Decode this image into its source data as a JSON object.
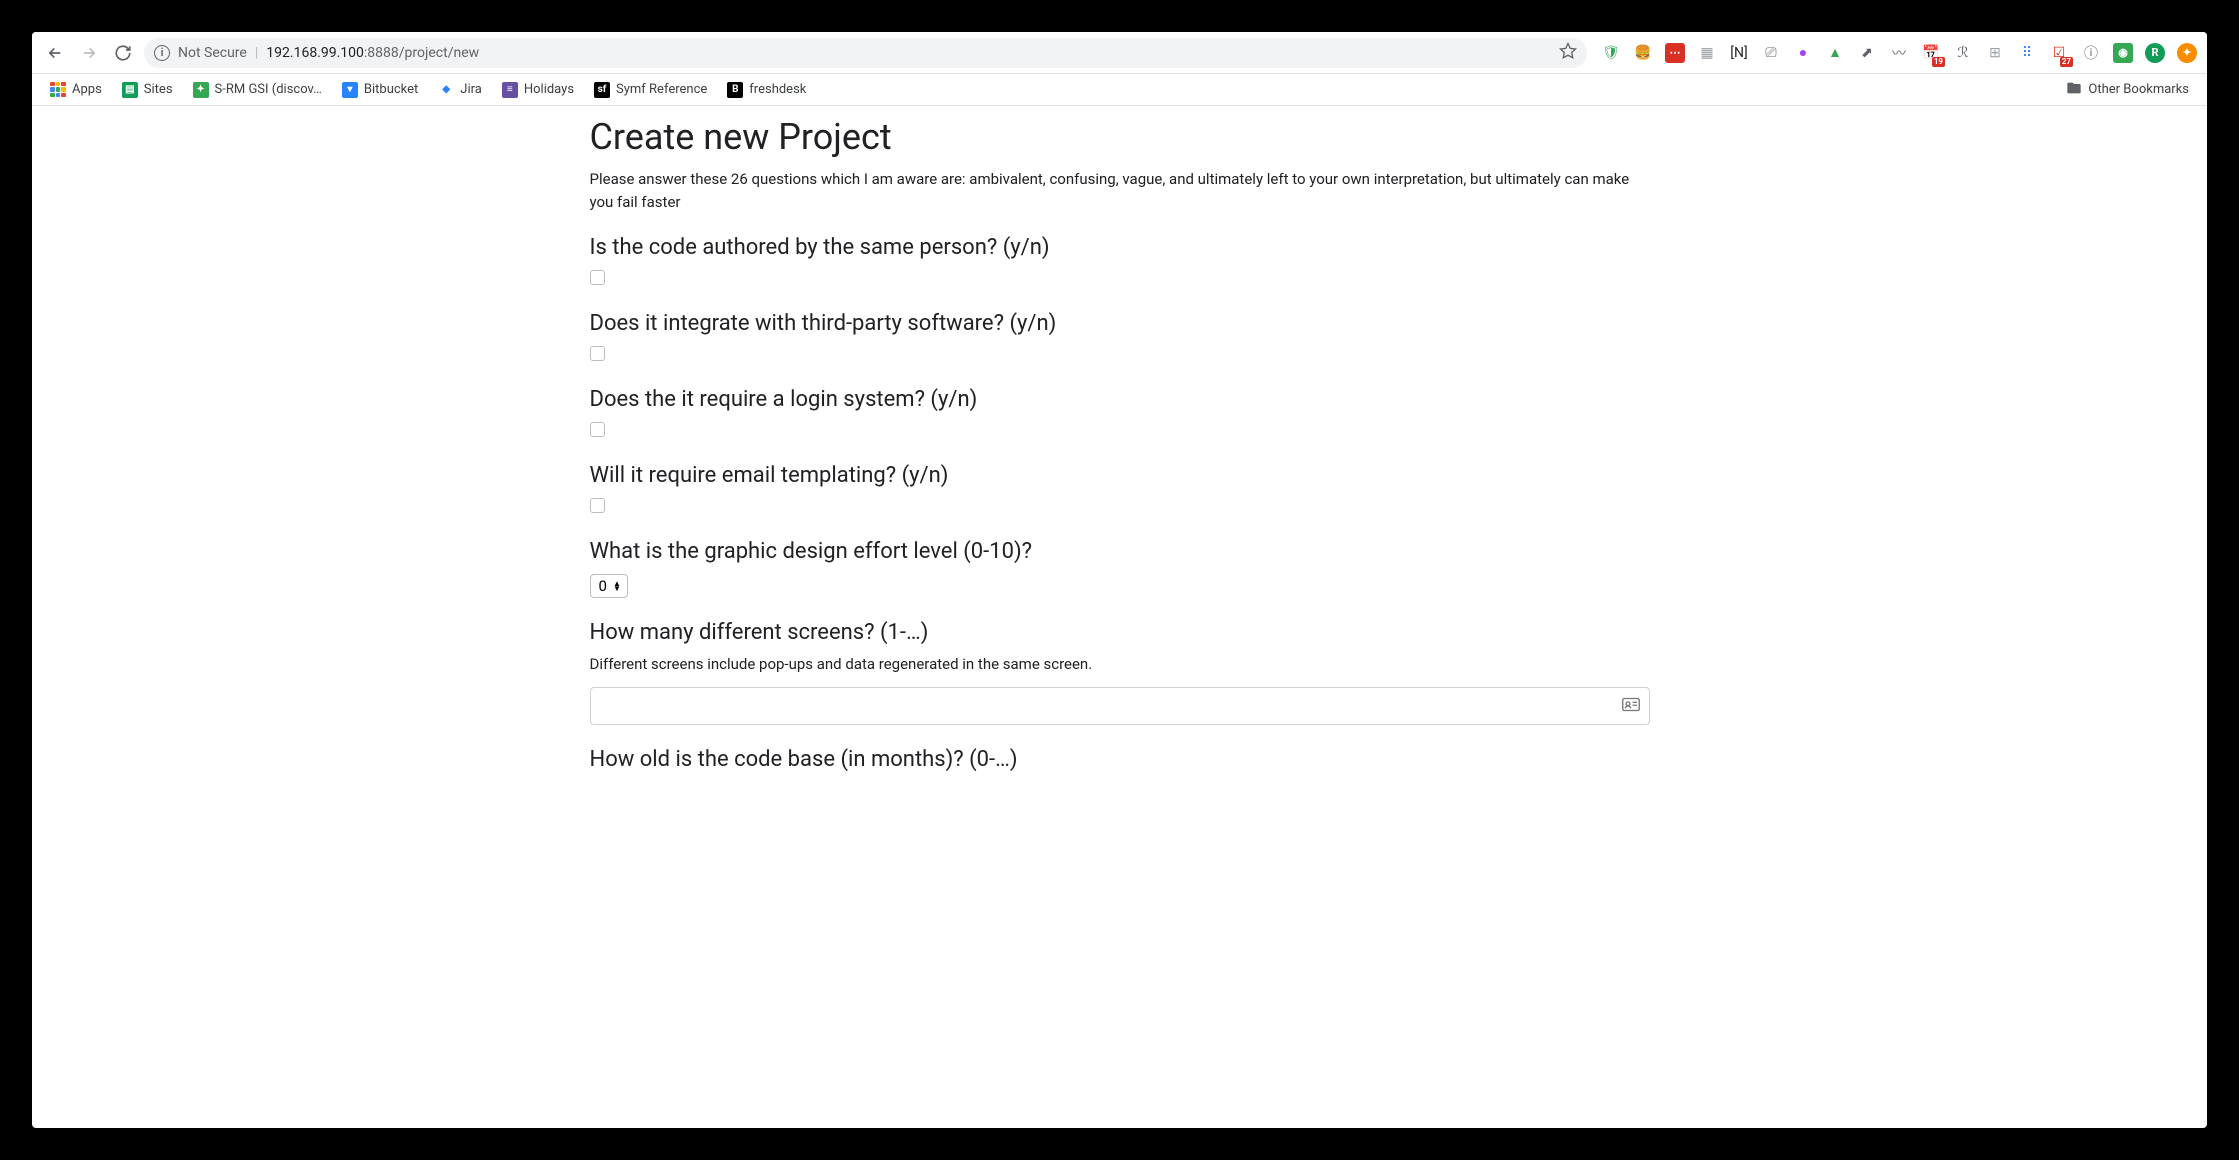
{
  "browser": {
    "security_label": "Not Secure",
    "url_host": "192.168.99.100",
    "url_port": ":8888",
    "url_path": "/project/new",
    "extensions": [
      {
        "name": "shield",
        "glyph": "🛡",
        "color": "#34a853"
      },
      {
        "name": "burger",
        "glyph": "🍔",
        "color": ""
      },
      {
        "name": "red-dots",
        "glyph": "⋯",
        "bg": "#d93025",
        "fg": "#fff"
      },
      {
        "name": "gray-box",
        "glyph": "▦",
        "color": "#9aa0a6"
      },
      {
        "name": "n-bracket",
        "glyph": "[N]",
        "color": "#202124"
      },
      {
        "name": "cast",
        "glyph": "⎚",
        "color": "#5f6368"
      },
      {
        "name": "purple-circle",
        "glyph": "●",
        "color": "#a142f4"
      },
      {
        "name": "adidas",
        "glyph": "▲",
        "color": "#34a853"
      },
      {
        "name": "arrow-box",
        "glyph": "⬈",
        "color": "#5f6368"
      },
      {
        "name": "wave",
        "glyph": "〰",
        "color": "#5f6368"
      },
      {
        "name": "calendar-badge",
        "glyph": "📅",
        "badge": "19"
      },
      {
        "name": "rabbit",
        "glyph": "ℛ",
        "color": "#5f6368"
      },
      {
        "name": "grid",
        "glyph": "⊞",
        "color": "#9aa0a6"
      },
      {
        "name": "dots-blue",
        "glyph": "⠿",
        "color": "#4285f4"
      },
      {
        "name": "todo-badge",
        "glyph": "☑",
        "badge": "27",
        "color": "#d93025"
      },
      {
        "name": "info",
        "glyph": "ⓘ",
        "color": "#5f6368"
      },
      {
        "name": "green-box",
        "glyph": "◉",
        "bg": "#34a853",
        "fg": "#fff"
      },
      {
        "name": "avatar-r",
        "glyph": "R",
        "bg": "#0f9d58",
        "fg": "#fff",
        "round": true
      },
      {
        "name": "orange-circle",
        "glyph": "✦",
        "bg": "#fb8c00",
        "fg": "#fff",
        "round": true
      }
    ]
  },
  "bookmarks": {
    "apps_label": "Apps",
    "items": [
      {
        "label": "Sites",
        "favicon_bg": "#0f9d58",
        "favicon_text": "▤"
      },
      {
        "label": "S-RM GSI (discov…",
        "favicon_bg": "#34a853",
        "favicon_text": "✦"
      },
      {
        "label": "Bitbucket",
        "favicon_bg": "#2684ff",
        "favicon_text": "▾"
      },
      {
        "label": "Jira",
        "favicon_bg": "#fff",
        "favicon_text": "◆",
        "favicon_fg": "#2684ff"
      },
      {
        "label": "Holidays",
        "favicon_bg": "#6750a4",
        "favicon_text": "≡"
      },
      {
        "label": "Symf Reference",
        "favicon_bg": "#000",
        "favicon_text": "sf"
      },
      {
        "label": "freshdesk",
        "favicon_bg": "#000",
        "favicon_text": "B"
      }
    ],
    "other_label": "Other Bookmarks"
  },
  "page": {
    "title": "Create new Project",
    "intro": "Please answer these 26 questions which I am aware are: ambivalent, confusing, vague, and ultimately left to your own interpretation, but ultimately can make you fail faster",
    "q1_label": "Is the code authored by the same person? (y/n)",
    "q2_label": "Does it integrate with third-party software? (y/n)",
    "q3_label": "Does the it require a login system? (y/n)",
    "q4_label": "Will it require email templating? (y/n)",
    "q5_label": "What is the graphic design effort level (0-10)?",
    "q5_value": "0",
    "q6_label": "How many different screens? (1-…)",
    "q6_help": "Different screens include pop-ups and data regenerated in the same screen.",
    "q6_value": "",
    "q7_label": "How old is the code base (in months)? (0-…)"
  }
}
